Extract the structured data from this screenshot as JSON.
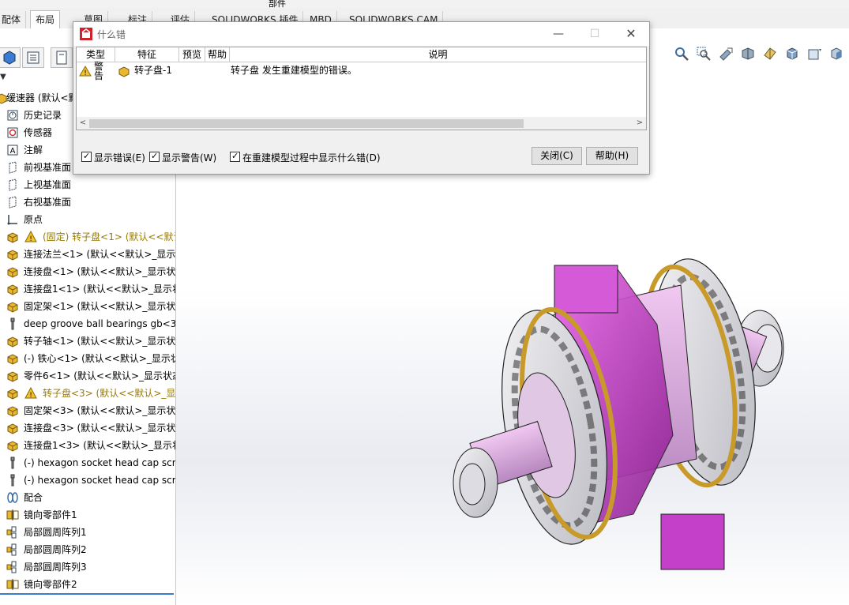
{
  "ribbon": {
    "top_labels": [
      "部件"
    ],
    "tabs": [
      "配体",
      "布局",
      "草图",
      "标注",
      "评估",
      "SOLIDWORKS 插件",
      "MBD",
      "SOLIDWORKS CAM"
    ],
    "active_tab": "布局"
  },
  "view_tools": [
    "zoom-to-fit-icon",
    "zoom-area-icon",
    "previous-view-icon",
    "section-view-icon",
    "view-orientation-icon",
    "display-style-icon",
    "hide-show-icon",
    "appearance-icon"
  ],
  "tree": {
    "filter": "▼",
    "root": "缓速器 (默认<默",
    "items": [
      {
        "label": "历史记录",
        "icon": "history-icon",
        "warn": false
      },
      {
        "label": "传感器",
        "icon": "sensor-icon",
        "warn": false
      },
      {
        "label": "注解",
        "icon": "annotation-icon",
        "warn": false
      },
      {
        "label": "前视基准面",
        "icon": "plane-icon",
        "warn": false
      },
      {
        "label": "上视基准面",
        "icon": "plane-icon",
        "warn": false
      },
      {
        "label": "右视基准面",
        "icon": "plane-icon",
        "warn": false
      },
      {
        "label": "原点",
        "icon": "origin-icon",
        "warn": false
      },
      {
        "label": "(固定) 转子盘<1> (默认<<默认",
        "icon": "part-icon",
        "warn": true
      },
      {
        "label": "连接法兰<1> (默认<<默认>_显示状",
        "icon": "part-icon",
        "warn": false
      },
      {
        "label": "连接盘<1> (默认<<默认>_显示状态",
        "icon": "part-icon",
        "warn": false
      },
      {
        "label": "连接盘1<1> (默认<<默认>_显示状",
        "icon": "part-icon",
        "warn": false
      },
      {
        "label": "固定架<1> (默认<<默认>_显示状态",
        "icon": "part-icon",
        "warn": false
      },
      {
        "label": "deep groove ball bearings gb<3",
        "icon": "toolbox-icon",
        "warn": false
      },
      {
        "label": "转子轴<1> (默认<<默认>_显示状态",
        "icon": "part-icon",
        "warn": false
      },
      {
        "label": "(-) 铁心<1> (默认<<默认>_显示状",
        "icon": "part-icon",
        "warn": false
      },
      {
        "label": "零件6<1> (默认<<默认>_显示状态",
        "icon": "part-icon",
        "warn": false
      },
      {
        "label": "转子盘<3> (默认<<默认>_显示",
        "icon": "part-icon",
        "warn": true
      },
      {
        "label": "固定架<3> (默认<<默认>_显示状态",
        "icon": "part-icon",
        "warn": false
      },
      {
        "label": "连接盘<3> (默认<<默认>_显示状态",
        "icon": "part-icon",
        "warn": false
      },
      {
        "label": "连接盘1<3> (默认<<默认>_显示状",
        "icon": "part-icon",
        "warn": false
      },
      {
        "label": "(-) hexagon socket head cap scre",
        "icon": "toolbox-icon",
        "warn": false
      },
      {
        "label": "(-) hexagon socket head cap scre",
        "icon": "toolbox-icon",
        "warn": false
      },
      {
        "label": "配合",
        "icon": "mates-icon",
        "warn": false
      },
      {
        "label": "镜向零部件1",
        "icon": "mirror-icon",
        "warn": false
      },
      {
        "label": "局部圆周阵列1",
        "icon": "pattern-icon",
        "warn": false
      },
      {
        "label": "局部圆周阵列2",
        "icon": "pattern-icon",
        "warn": false
      },
      {
        "label": "局部圆周阵列3",
        "icon": "pattern-icon",
        "warn": false
      },
      {
        "label": "镜向零部件2",
        "icon": "mirror-icon",
        "warn": false
      }
    ]
  },
  "dialog": {
    "title": "什么错",
    "columns": [
      "类型",
      "特征",
      "预览",
      "帮助",
      "说明"
    ],
    "rows": [
      {
        "type": "警告",
        "feature": "转子盘-1",
        "preview": "",
        "help": "",
        "description": "转子盘 发生重建模型的错误。"
      }
    ],
    "checkboxes": [
      {
        "label": "显示错误(E)",
        "checked": true
      },
      {
        "label": "显示警告(W)",
        "checked": true
      },
      {
        "label": "在重建模型过程中显示什么错(D)",
        "checked": true
      }
    ],
    "close_label": "关闭(C)",
    "help_label": "帮助(H)"
  },
  "colors": {
    "magenta": "#d040d8",
    "gold": "#c89a2a",
    "steel": "#d8d8dc",
    "accent": "#3a7bd5",
    "warn": "#f2c12e"
  }
}
